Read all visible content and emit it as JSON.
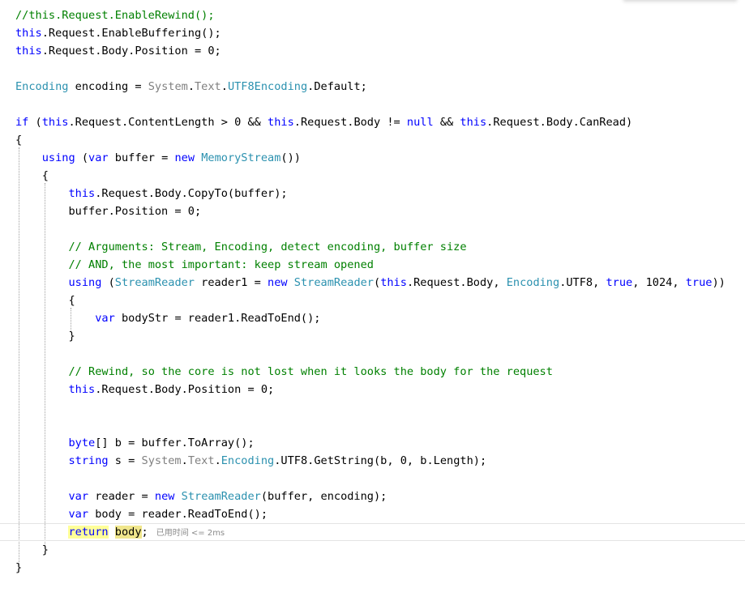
{
  "editor": {
    "colors": {
      "keyword": "#0000ff",
      "type": "#2b91af",
      "namespace": "#808080",
      "comment": "#008000",
      "text": "#000000",
      "current_line_border": "#e4e4e4",
      "reference_highlight": "#f0e68c"
    },
    "performance_hint": "已用时间 <= 2ms",
    "lines": [
      [
        [
          "cm",
          "//this.Request.EnableRewind();"
        ]
      ],
      [
        [
          "this",
          "this"
        ],
        [
          "p",
          ".Request.EnableBuffering();"
        ]
      ],
      [
        [
          "this",
          "this"
        ],
        [
          "p",
          ".Request.Body.Position = 0;"
        ]
      ],
      [],
      [
        [
          "type",
          "Encoding"
        ],
        [
          "p",
          " encoding = "
        ],
        [
          "ns",
          "System"
        ],
        [
          "p",
          "."
        ],
        [
          "ns",
          "Text"
        ],
        [
          "p",
          "."
        ],
        [
          "type",
          "UTF8Encoding"
        ],
        [
          "p",
          ".Default;"
        ]
      ],
      [],
      [
        [
          "kw",
          "if"
        ],
        [
          "p",
          " ("
        ],
        [
          "this",
          "this"
        ],
        [
          "p",
          ".Request.ContentLength > 0 && "
        ],
        [
          "this",
          "this"
        ],
        [
          "p",
          ".Request.Body != "
        ],
        [
          "kw",
          "null"
        ],
        [
          "p",
          " && "
        ],
        [
          "this",
          "this"
        ],
        [
          "p",
          ".Request.Body.CanRead)"
        ]
      ],
      [
        [
          "p",
          "{"
        ]
      ],
      [
        [
          "p",
          "    "
        ],
        [
          "kw",
          "using"
        ],
        [
          "p",
          " ("
        ],
        [
          "kw",
          "var"
        ],
        [
          "p",
          " buffer = "
        ],
        [
          "kw",
          "new"
        ],
        [
          "p",
          " "
        ],
        [
          "type",
          "MemoryStream"
        ],
        [
          "p",
          "())"
        ]
      ],
      [
        [
          "p",
          "    {"
        ]
      ],
      [
        [
          "p",
          "        "
        ],
        [
          "this",
          "this"
        ],
        [
          "p",
          ".Request.Body.CopyTo(buffer);"
        ]
      ],
      [
        [
          "p",
          "        buffer.Position = 0;"
        ]
      ],
      [],
      [
        [
          "p",
          "        "
        ],
        [
          "cm",
          "// Arguments: Stream, Encoding, detect encoding, buffer size"
        ]
      ],
      [
        [
          "p",
          "        "
        ],
        [
          "cm",
          "// AND, the most important: keep stream opened"
        ]
      ],
      [
        [
          "p",
          "        "
        ],
        [
          "kw",
          "using"
        ],
        [
          "p",
          " ("
        ],
        [
          "type",
          "StreamReader"
        ],
        [
          "p",
          " reader1 = "
        ],
        [
          "kw",
          "new"
        ],
        [
          "p",
          " "
        ],
        [
          "type",
          "StreamReader"
        ],
        [
          "p",
          "("
        ],
        [
          "this",
          "this"
        ],
        [
          "p",
          ".Request.Body, "
        ],
        [
          "type",
          "Encoding"
        ],
        [
          "p",
          ".UTF8, "
        ],
        [
          "kw",
          "true"
        ],
        [
          "p",
          ", 1024, "
        ],
        [
          "kw",
          "true"
        ],
        [
          "p",
          "))"
        ]
      ],
      [
        [
          "p",
          "        {"
        ]
      ],
      [
        [
          "p",
          "            "
        ],
        [
          "kw",
          "var"
        ],
        [
          "p",
          " bodyStr = reader1.ReadToEnd();"
        ]
      ],
      [
        [
          "p",
          "        }"
        ]
      ],
      [],
      [
        [
          "p",
          "        "
        ],
        [
          "cm",
          "// Rewind, so the core is not lost when it looks the body for the request"
        ]
      ],
      [
        [
          "p",
          "        "
        ],
        [
          "this",
          "this"
        ],
        [
          "p",
          ".Request.Body.Position = 0;"
        ]
      ],
      [],
      [],
      [
        [
          "p",
          "        "
        ],
        [
          "kw",
          "byte"
        ],
        [
          "p",
          "[] b = buffer.ToArray();"
        ]
      ],
      [
        [
          "p",
          "        "
        ],
        [
          "kw",
          "string"
        ],
        [
          "p",
          " s = "
        ],
        [
          "ns",
          "System"
        ],
        [
          "p",
          "."
        ],
        [
          "ns",
          "Text"
        ],
        [
          "p",
          "."
        ],
        [
          "type",
          "Encoding"
        ],
        [
          "p",
          ".UTF8.GetString(b, 0, b.Length);"
        ]
      ],
      [],
      [
        [
          "p",
          "        "
        ],
        [
          "kw",
          "var"
        ],
        [
          "p",
          " reader = "
        ],
        [
          "kw",
          "new"
        ],
        [
          "p",
          " "
        ],
        [
          "type",
          "StreamReader"
        ],
        [
          "p",
          "(buffer, encoding);"
        ]
      ],
      [
        [
          "p",
          "        "
        ],
        [
          "kw",
          "var"
        ],
        [
          "p",
          " body = reader.ReadToEnd();"
        ]
      ],
      [
        [
          "p",
          "        "
        ],
        [
          "kwret",
          "return"
        ],
        [
          "p",
          " "
        ],
        [
          "hlbody",
          "body"
        ],
        [
          "p",
          ";"
        ],
        [
          "hint",
          ""
        ]
      ],
      [
        [
          "p",
          "    }"
        ]
      ],
      [
        [
          "p",
          "}"
        ]
      ]
    ]
  }
}
